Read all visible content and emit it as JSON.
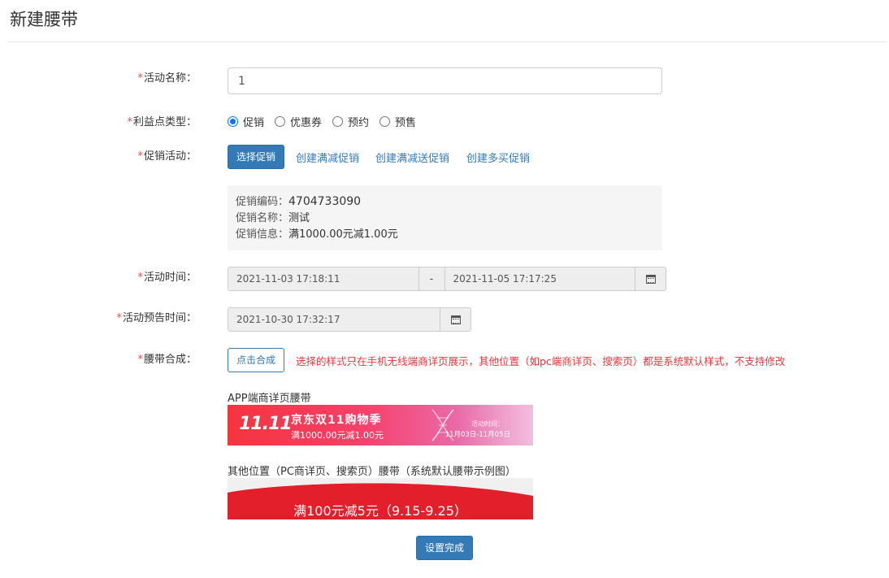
{
  "page": {
    "title": "新建腰带"
  },
  "form": {
    "required_mark": "*",
    "activity_name": {
      "label": "活动名称：",
      "value": "1"
    },
    "benefit_type": {
      "label": "利益点类型：",
      "options": [
        "促销",
        "优惠券",
        "预约",
        "预售"
      ],
      "selected": "促销"
    },
    "promo_activity": {
      "label": "促销活动：",
      "select_button": "选择促销",
      "links": [
        "创建满减促销",
        "创建满减送促销",
        "创建多买促销"
      ],
      "info": {
        "code_label": "促销编码：",
        "code": "4704733090",
        "name_label": "促销名称：",
        "name": "测试",
        "info_label": "促销信息：",
        "info": "满1000.00元减1.00元"
      }
    },
    "activity_time": {
      "label": "活动时间：",
      "start": "2021-11-03 17:18:11",
      "separator": "-",
      "end": "2021-11-05 17:17:25"
    },
    "preview_time": {
      "label": "活动预告时间：",
      "value": "2021-10-30 17:32:17"
    },
    "belt_compose": {
      "label": "腰带合成：",
      "button": "点击合成",
      "warning": "选择的样式只在手机无线端商详页展示，其他位置（如pc端商详页、搜索页）都是系统默认样式，不支持修改"
    },
    "app_banner": {
      "title": "APP端商详页腰带",
      "logo": "11.11",
      "headline": "京东双11购物季",
      "subline": "满1000.00元减1.00元",
      "time_label": "活动时间：",
      "time_range": "11月03日-11月05日"
    },
    "pc_banner": {
      "title": "其他位置（PC商详页、搜索页）腰带（系统默认腰带示例图）",
      "text": "满100元减5元（9.15-9.25）"
    },
    "done_button": "设置完成"
  },
  "colors": {
    "primary": "#337ab7",
    "required": "#d9534f",
    "warning": "#e4393c",
    "radio_checked": "#0075ff"
  }
}
